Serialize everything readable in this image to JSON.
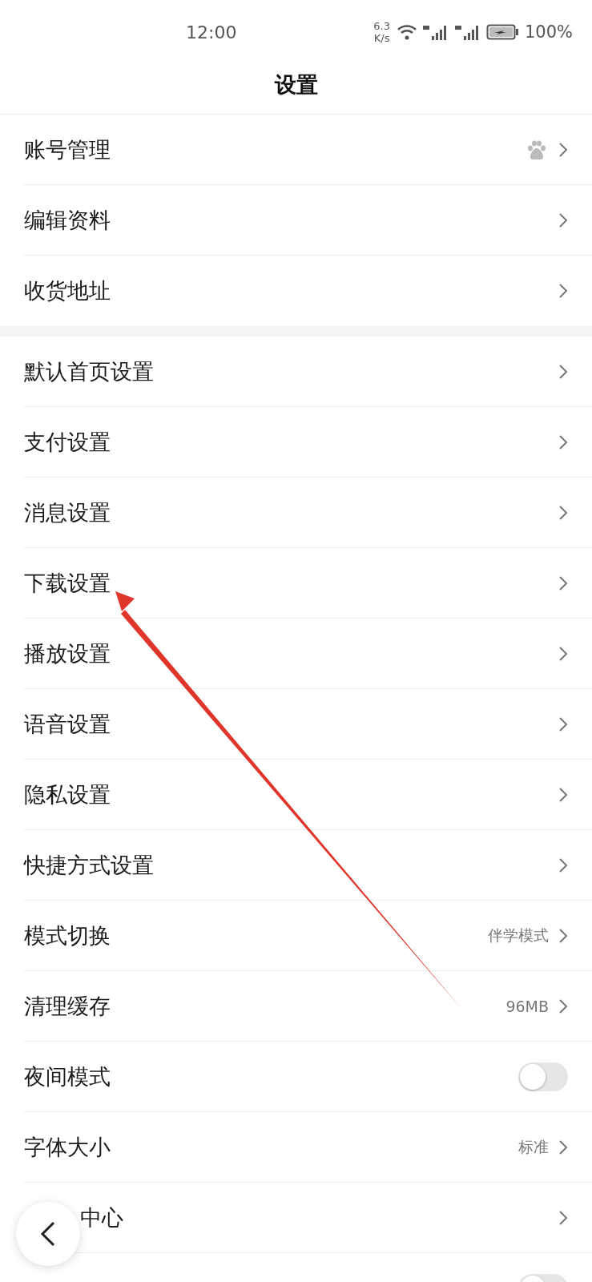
{
  "status_bar": {
    "time": "12:00",
    "speed_value": "6.3",
    "speed_unit": "K/s",
    "battery": "100%"
  },
  "title": "设置",
  "groups": [
    {
      "items": [
        {
          "kind": "account",
          "label": "账号管理"
        },
        {
          "kind": "link",
          "label": "编辑资料"
        },
        {
          "kind": "link",
          "label": "收货地址"
        }
      ]
    },
    {
      "items": [
        {
          "kind": "link",
          "label": "默认首页设置"
        },
        {
          "kind": "link",
          "label": "支付设置"
        },
        {
          "kind": "link",
          "label": "消息设置"
        },
        {
          "kind": "link",
          "label": "下载设置"
        },
        {
          "kind": "link",
          "label": "播放设置"
        },
        {
          "kind": "link",
          "label": "语音设置"
        },
        {
          "kind": "link",
          "label": "隐私设置"
        },
        {
          "kind": "link",
          "label": "快捷方式设置"
        },
        {
          "kind": "link",
          "label": "模式切换",
          "value": "伴学模式"
        },
        {
          "kind": "link",
          "label": "清理缓存",
          "value": "96MB"
        },
        {
          "kind": "toggle",
          "label": "夜间模式",
          "on": false
        },
        {
          "kind": "link",
          "label": "字体大小",
          "value": "标准"
        },
        {
          "kind": "link",
          "label": "中心",
          "covered": true
        },
        {
          "kind": "toggle",
          "on": false
        }
      ]
    }
  ]
}
